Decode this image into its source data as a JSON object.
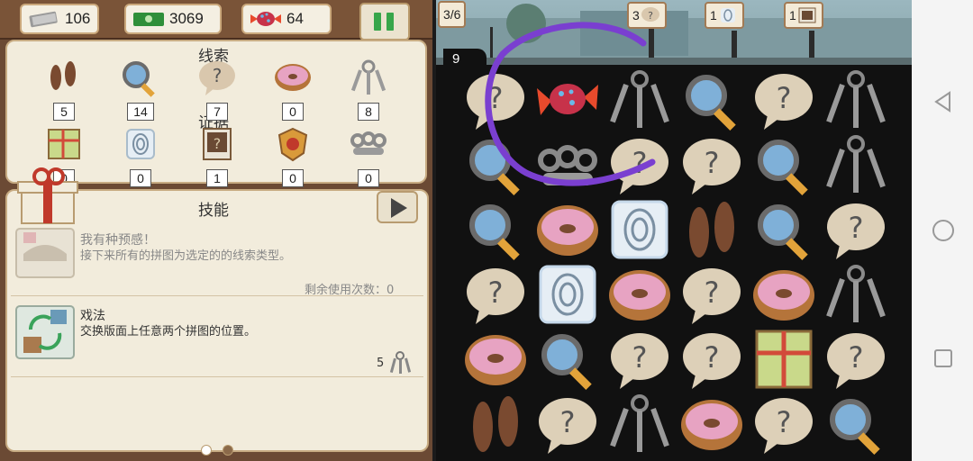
{
  "resources": [
    {
      "icon": "money-icon",
      "value": "106"
    },
    {
      "icon": "cash-icon",
      "value": "3069"
    },
    {
      "icon": "candy-icon",
      "value": "64"
    }
  ],
  "clues": {
    "title": "线索",
    "items": [
      {
        "icon": "footprints-icon",
        "count": "5"
      },
      {
        "icon": "magnifier-icon",
        "count": "14"
      },
      {
        "icon": "question-bubble-icon",
        "count": "7"
      },
      {
        "icon": "donut-icon",
        "count": "0"
      },
      {
        "icon": "keys-icon",
        "count": "8"
      }
    ]
  },
  "evidence": {
    "title": "证据",
    "items": [
      {
        "icon": "map-icon",
        "count": "0"
      },
      {
        "icon": "fingerprint-icon",
        "count": "0"
      },
      {
        "icon": "photo-icon",
        "count": "1"
      },
      {
        "icon": "badge-icon",
        "count": "0"
      },
      {
        "icon": "knuckles-icon",
        "count": "0"
      }
    ]
  },
  "skills": {
    "title": "技能",
    "list": [
      {
        "name": "我有种预感！",
        "desc": "接下来所有的拼图为选定的的线索类型。",
        "uses_label": "剩余使用次数：0"
      },
      {
        "name": "戏法",
        "desc": "交换版面上任意两个拼图的位置。",
        "cost": "5"
      }
    ]
  },
  "board": {
    "progress": "3/6",
    "moves": "9",
    "targets": [
      {
        "icon": "question-bubble-icon",
        "count": "3"
      },
      {
        "icon": "fingerprint-icon",
        "count": "1"
      },
      {
        "icon": "photo-icon",
        "count": "1"
      }
    ],
    "grid": [
      [
        "question",
        "candy",
        "keys",
        "magnifier",
        "question",
        "keys"
      ],
      [
        "magnifier",
        "knuckles",
        "question",
        "question",
        "magnifier",
        "keys"
      ],
      [
        "magnifier",
        "donut",
        "fingerprint",
        "footprints",
        "magnifier",
        "question"
      ],
      [
        "question",
        "fingerprint",
        "donut",
        "question",
        "donut",
        "keys"
      ],
      [
        "donut",
        "magnifier",
        "question",
        "question",
        "map",
        "question"
      ],
      [
        "footprints",
        "question",
        "keys",
        "donut",
        "question",
        "magnifier"
      ]
    ]
  },
  "colors": {
    "accent": "#7a3fd0",
    "panel": "#f2ecdc",
    "frame": "#6b4a34"
  }
}
